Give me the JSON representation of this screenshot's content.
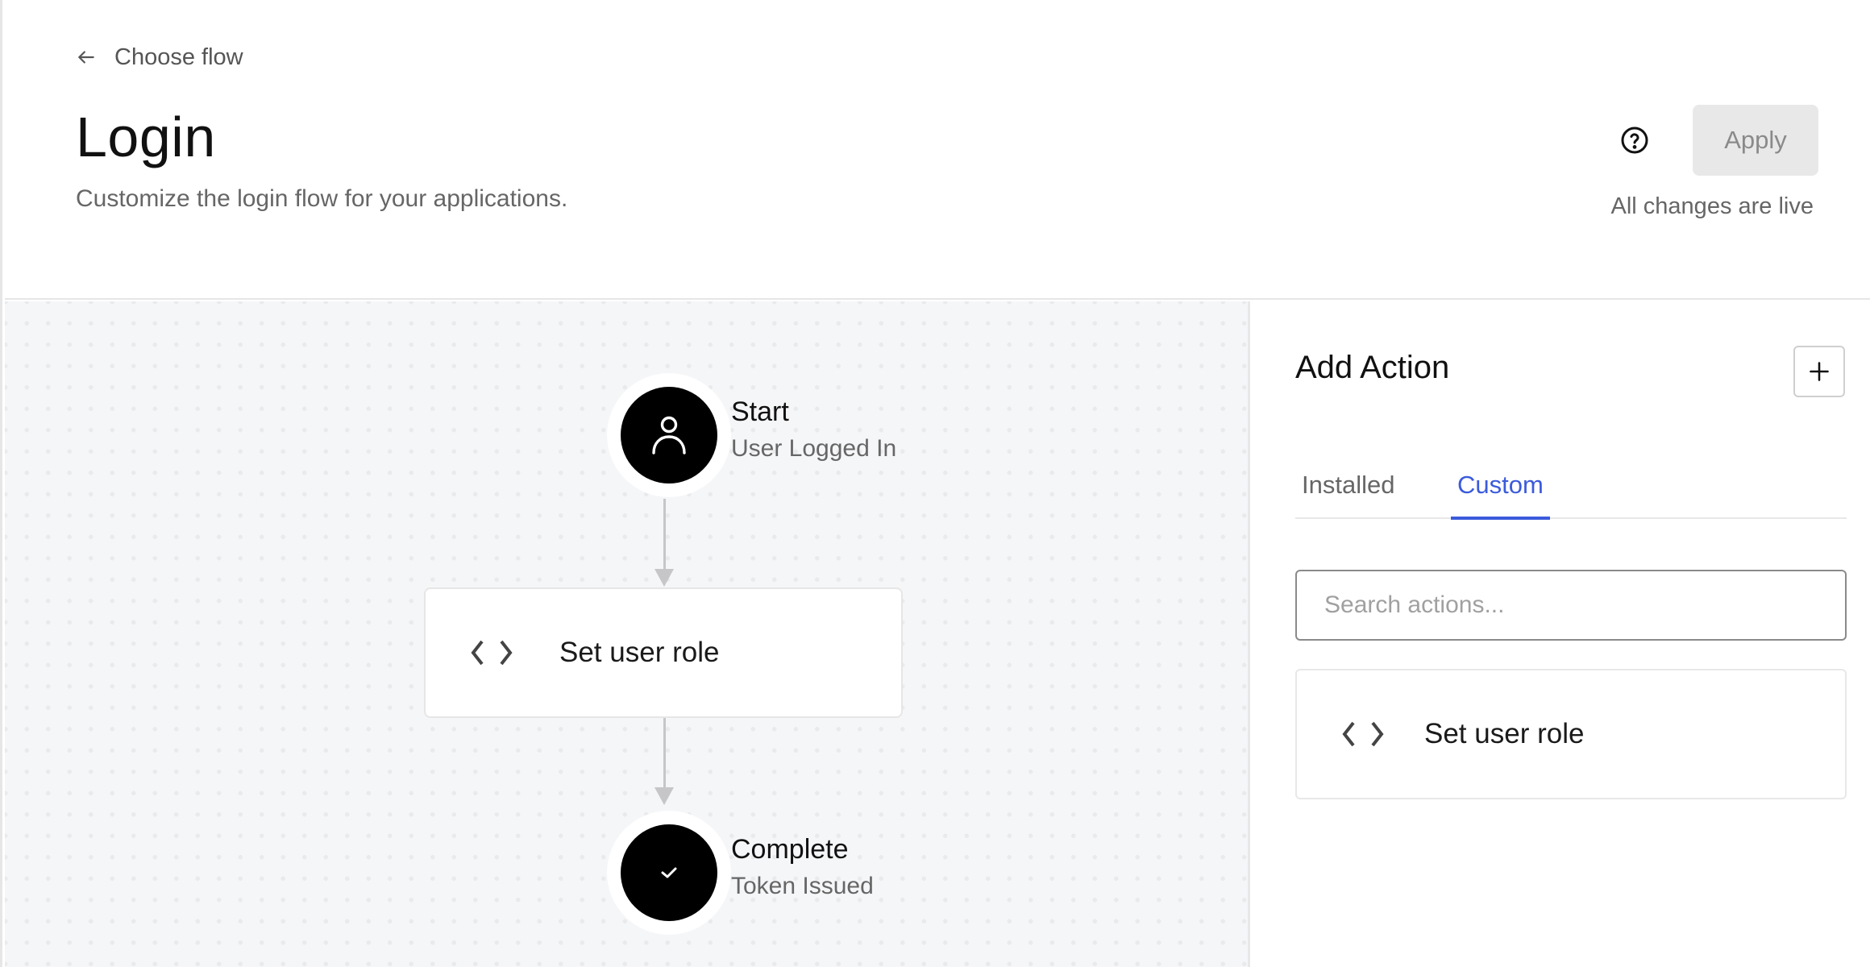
{
  "header": {
    "back_link_label": "Choose flow",
    "title": "Login",
    "subtitle": "Customize the login flow for your applications.",
    "apply_label": "Apply",
    "apply_disabled": true,
    "status_text": "All changes are live",
    "icons": {
      "back": "arrow-left-icon",
      "help": "question-circle-icon"
    }
  },
  "flow": {
    "start": {
      "label": "Start",
      "sublabel": "User Logged In",
      "icon": "user-icon"
    },
    "actions": [
      {
        "label": "Set user role",
        "icon": "code-icon"
      }
    ],
    "complete": {
      "label": "Complete",
      "sublabel": "Token Issued",
      "icon": "check-icon"
    }
  },
  "panel": {
    "title": "Add Action",
    "add_button_icon": "plus-icon",
    "tabs": [
      {
        "label": "Installed",
        "active": false
      },
      {
        "label": "Custom",
        "active": true
      }
    ],
    "search": {
      "placeholder": "Search actions...",
      "value": ""
    },
    "actions": [
      {
        "label": "Set user role",
        "icon": "code-icon"
      }
    ]
  },
  "colors": {
    "accent": "#3b5bdb",
    "canvas_bg": "#f5f6f8",
    "node_fill": "#000000",
    "connector": "#c6c6c8",
    "apply_disabled_bg": "#e8e8e8"
  }
}
